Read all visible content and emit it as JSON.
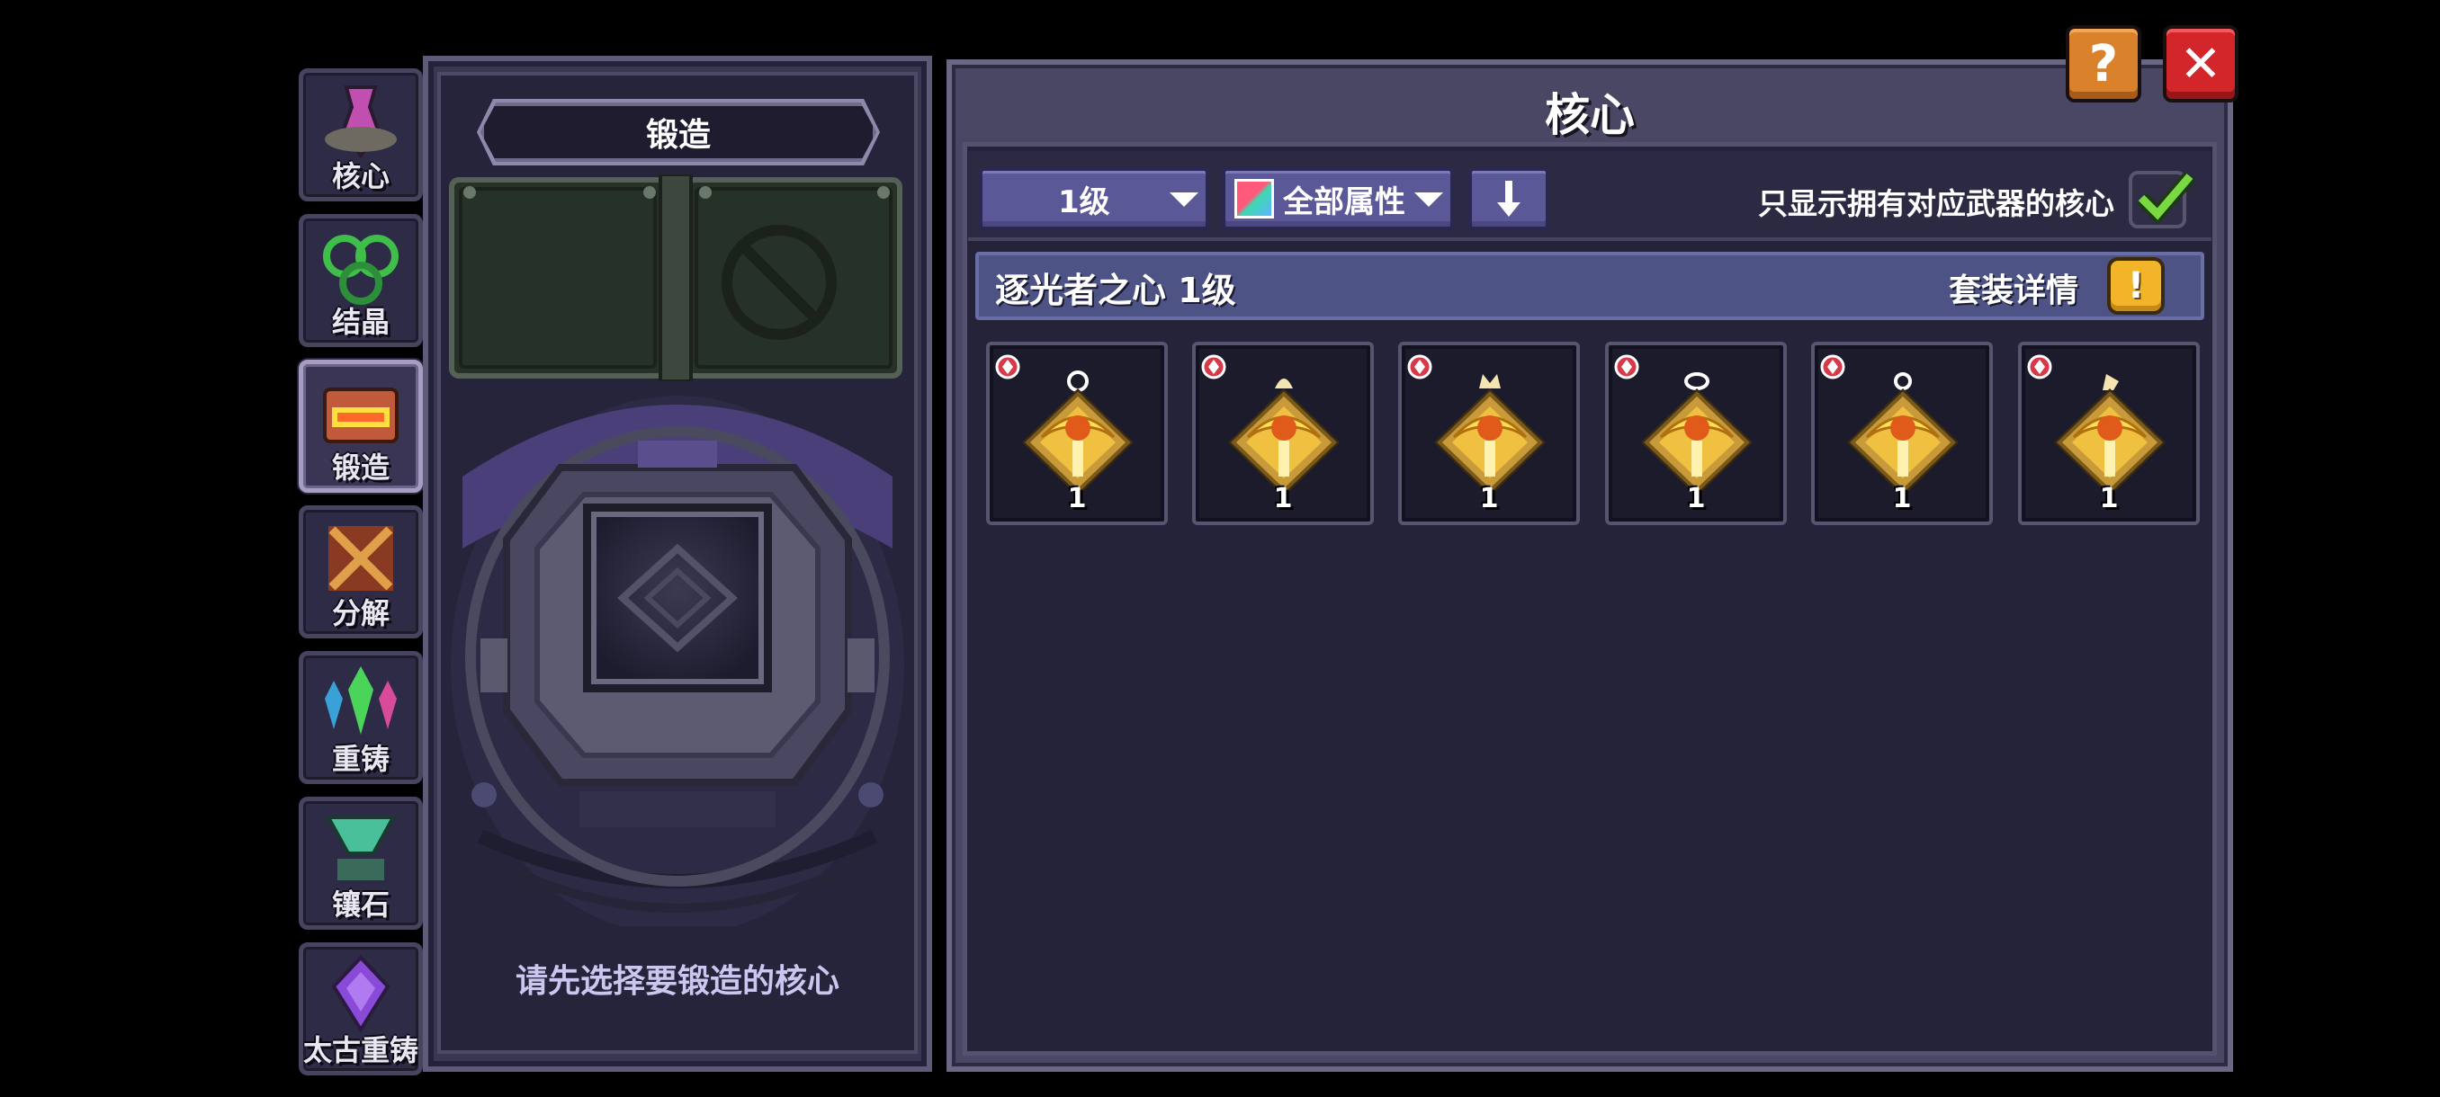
{
  "tabs": [
    {
      "label": "核心",
      "icon": "core-tab-icon",
      "active": false
    },
    {
      "label": "结晶",
      "icon": "crystal-tab-icon",
      "active": false
    },
    {
      "label": "锻造",
      "icon": "forge-tab-icon",
      "active": true
    },
    {
      "label": "分解",
      "icon": "disassemble-tab-icon",
      "active": false
    },
    {
      "label": "重铸",
      "icon": "recast-tab-icon",
      "active": false
    },
    {
      "label": "镶石",
      "icon": "inlay-tab-icon",
      "active": false
    },
    {
      "label": "太古重铸",
      "icon": "ancient-recast-tab-icon",
      "active": false
    }
  ],
  "forge": {
    "title": "锻造",
    "hint": "请先选择要锻造的核心"
  },
  "main": {
    "title": "核心",
    "level_filter": "1级",
    "attribute_filter": "全部属性",
    "sort_icon": "arrow-down-icon",
    "owned_toggle_label": "只显示拥有对应武器的核心",
    "owned_toggle_checked": true,
    "set_name": "逐光者之心 1级",
    "set_detail_label": "套装详情",
    "set_detail_icon_text": "!"
  },
  "cores": [
    {
      "level": "1",
      "variant": "ring-top"
    },
    {
      "level": "1",
      "variant": "bell-top"
    },
    {
      "level": "1",
      "variant": "crown-top"
    },
    {
      "level": "1",
      "variant": "loop-top"
    },
    {
      "level": "1",
      "variant": "small-loop-top"
    },
    {
      "level": "1",
      "variant": "horn-top"
    }
  ],
  "buttons": {
    "help": "?",
    "close": "✕"
  },
  "colors": {
    "accent_purple": "#5b5898",
    "gold": "#f2b428",
    "close_red": "#d3262b",
    "help_orange": "#d9822b",
    "check_green": "#6ed13a"
  }
}
